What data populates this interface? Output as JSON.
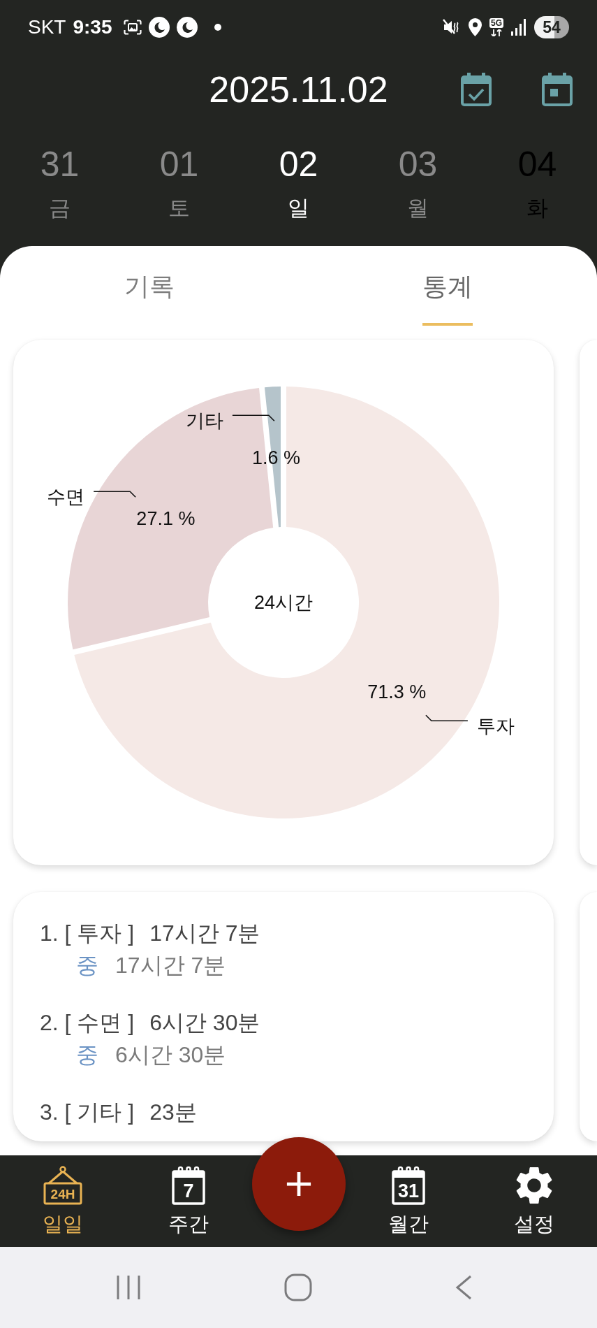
{
  "status_bar": {
    "carrier": "SKT",
    "time": "9:35",
    "network": "5G",
    "battery": "54"
  },
  "header": {
    "date": "2025.11.02"
  },
  "days": [
    {
      "date": "31",
      "weekday": "금",
      "selected": false,
      "color": "#8a8a8a"
    },
    {
      "date": "01",
      "weekday": "토",
      "selected": false,
      "color": "#8a8a8a"
    },
    {
      "date": "02",
      "weekday": "일",
      "selected": true
    },
    {
      "date": "03",
      "weekday": "월",
      "selected": false,
      "color": "#8a8a8a"
    },
    {
      "date": "04",
      "weekday": "화",
      "selected": false,
      "color": "#000000"
    }
  ],
  "tabs": [
    {
      "label": "기록",
      "selected": false
    },
    {
      "label": "통계",
      "selected": true
    }
  ],
  "chart_card": {
    "center_label": "24시간",
    "slices": [
      {
        "color": "#f5e9e6"
      },
      {
        "color": "#e8d5d6"
      },
      {
        "color": "#b5c4cb"
      }
    ],
    "chart_data": {
      "type": "donut",
      "categories": [
        "투자",
        "수면",
        "기타"
      ],
      "values": [
        71.3,
        27.1,
        1.6
      ],
      "value_labels": [
        "71.3 %",
        "27.1 %",
        "1.6 %"
      ]
    }
  },
  "summary": [
    {
      "label": "1. [ 투자 ]",
      "total": "17시간 7분",
      "details": [
        {
          "tag": "중",
          "duration": "17시간 7분"
        }
      ]
    },
    {
      "label": "2. [ 수면 ]",
      "total": "6시간 30분",
      "details": [
        {
          "tag": "중",
          "duration": "6시간 30분"
        }
      ]
    },
    {
      "label": "3. [ 기타 ]",
      "total": "23분"
    }
  ],
  "bottom_nav": [
    {
      "label": "일일",
      "kind": "daily",
      "icon_text": "24H",
      "selected": true
    },
    {
      "label": "주간",
      "kind": "weekly",
      "icon_text": "7",
      "selected": false
    },
    {
      "label": "월간",
      "kind": "monthly",
      "icon_text": "31",
      "selected": false
    },
    {
      "label": "설정",
      "kind": "settings",
      "selected": false
    }
  ]
}
